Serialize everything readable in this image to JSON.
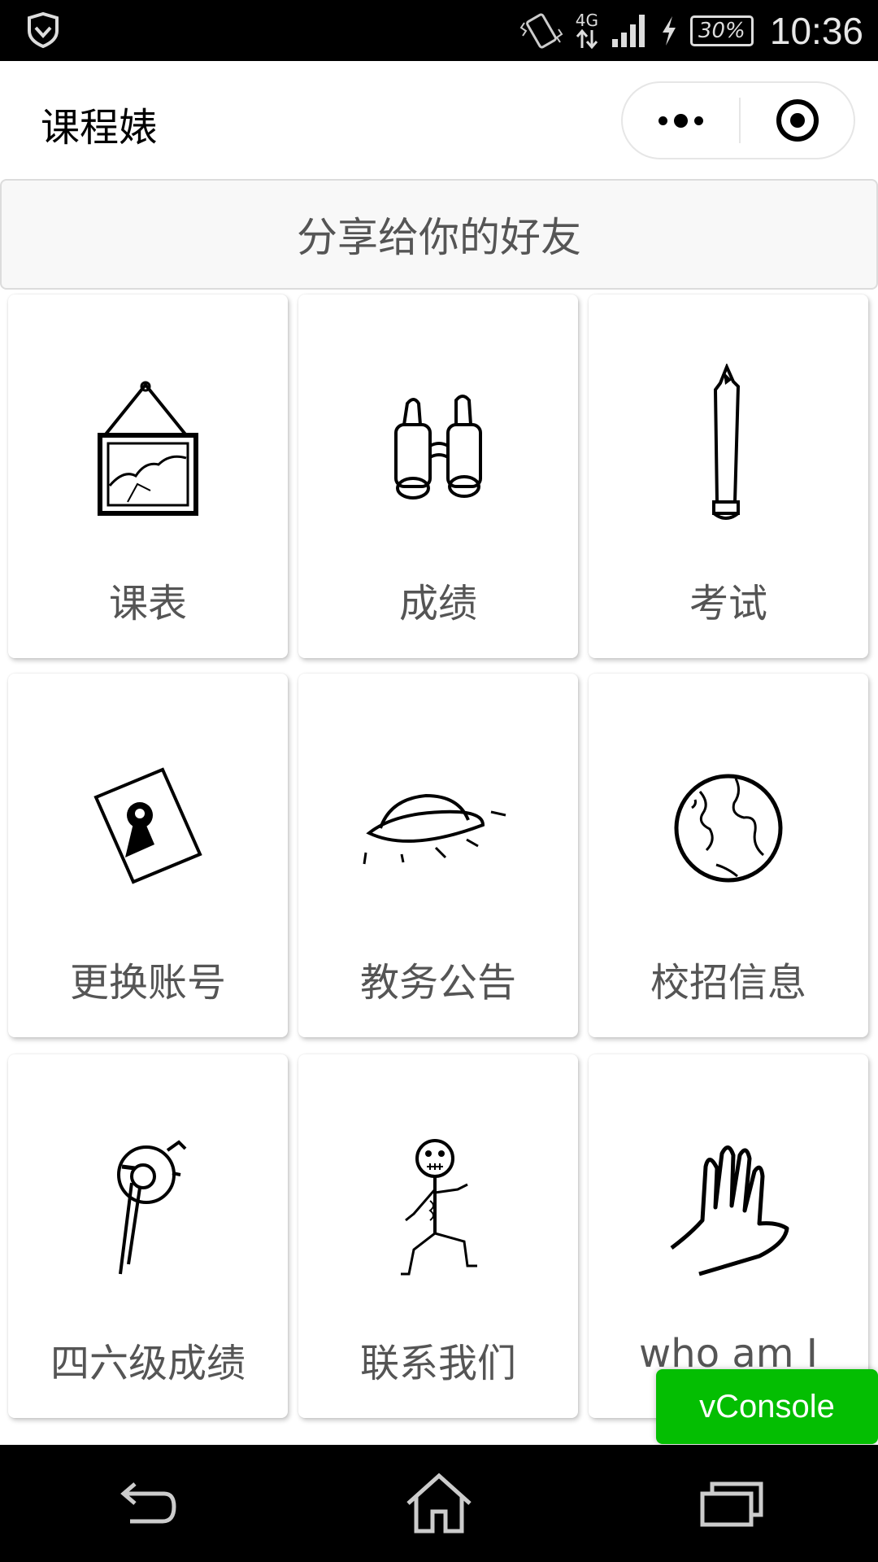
{
  "status_bar": {
    "network_type": "4G",
    "battery": "30%",
    "time": "10:36"
  },
  "nav": {
    "title": "课程婊"
  },
  "share": {
    "label": "分享给你的好友"
  },
  "grid": {
    "items": [
      {
        "label": "课表",
        "icon": "framed-picture-icon"
      },
      {
        "label": "成绩",
        "icon": "binoculars-icon"
      },
      {
        "label": "考试",
        "icon": "pencil-icon"
      },
      {
        "label": "更换账号",
        "icon": "keyhole-card-icon"
      },
      {
        "label": "教务公告",
        "icon": "ufo-icon"
      },
      {
        "label": "校招信息",
        "icon": "globe-icon"
      },
      {
        "label": "四六级成绩",
        "icon": "tape-roll-icon"
      },
      {
        "label": "联系我们",
        "icon": "stick-figure-icon"
      },
      {
        "label": "who am I",
        "icon": "waving-hand-icon"
      }
    ]
  },
  "vconsole": {
    "label": "vConsole",
    "color": "#04be02"
  }
}
